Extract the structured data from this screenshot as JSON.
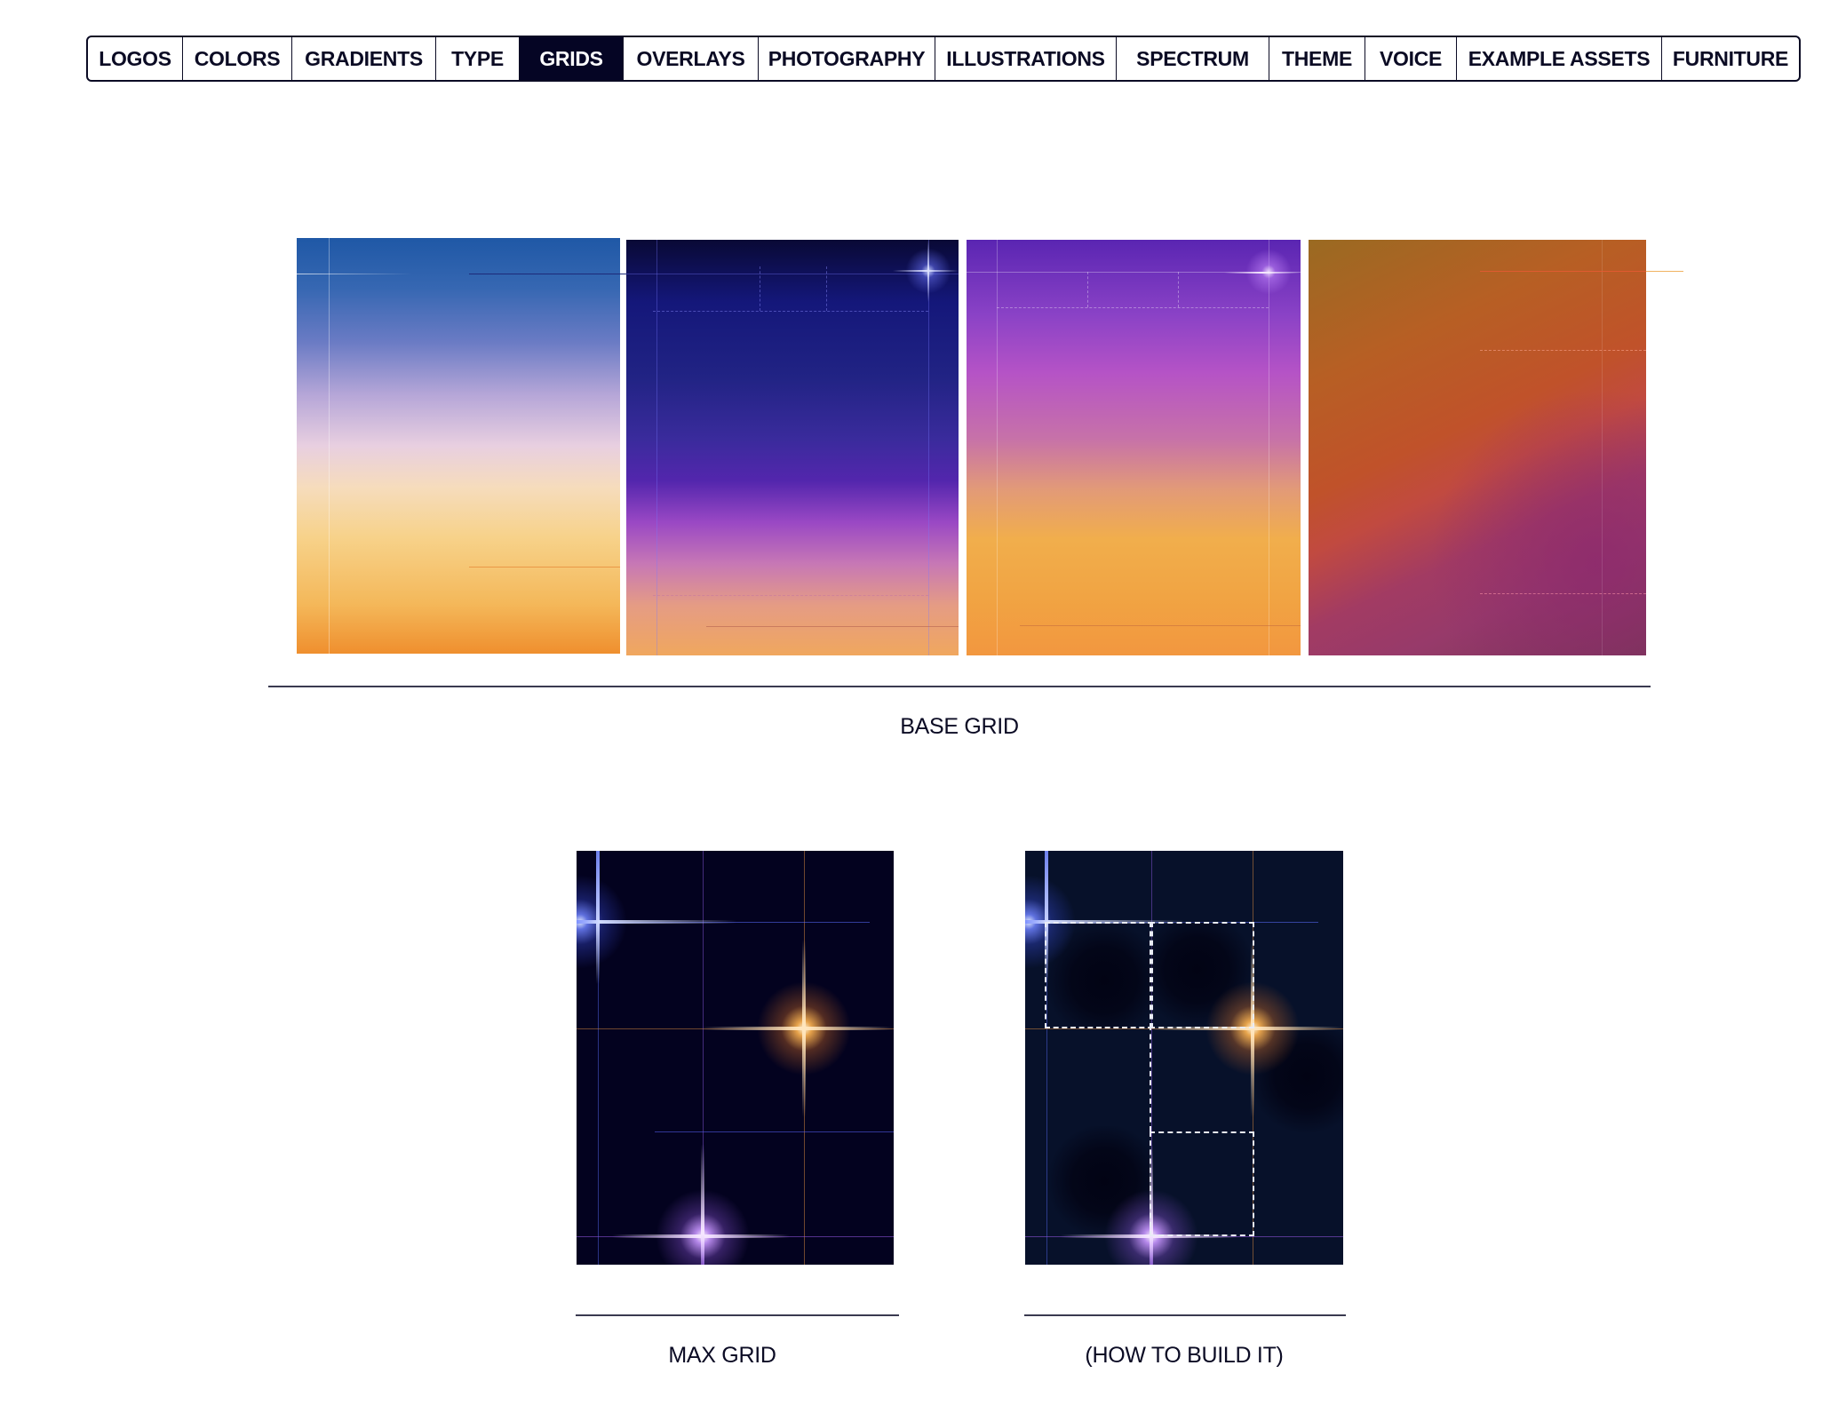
{
  "nav": {
    "items": [
      {
        "label": "LOGOS"
      },
      {
        "label": "COLORS"
      },
      {
        "label": "GRADIENTS"
      },
      {
        "label": "TYPE"
      },
      {
        "label": "GRIDS"
      },
      {
        "label": "OVERLAYS"
      },
      {
        "label": "PHOTOGRAPHY"
      },
      {
        "label": "ILLUSTRATIONS"
      },
      {
        "label": "SPECTRUM"
      },
      {
        "label": "THEME"
      },
      {
        "label": "VOICE"
      },
      {
        "label": "EXAMPLE ASSETS"
      },
      {
        "label": "FURNITURE"
      }
    ],
    "active": "GRIDS"
  },
  "sections": {
    "base_grid": {
      "caption": "BASE GRID"
    },
    "max_grid": {
      "caption": "MAX GRID"
    },
    "how_to_build": {
      "caption": "(HOW TO BUILD IT)"
    }
  },
  "colors": {
    "ink": "#0b0b24",
    "active_nav_bg": "#050524",
    "dark_panel": "#03021f",
    "dark_panel_alt": "#07112a",
    "glow_blue": "#6f8cff",
    "glow_orange": "#ffb14a",
    "glow_violet": "#c58cff"
  }
}
